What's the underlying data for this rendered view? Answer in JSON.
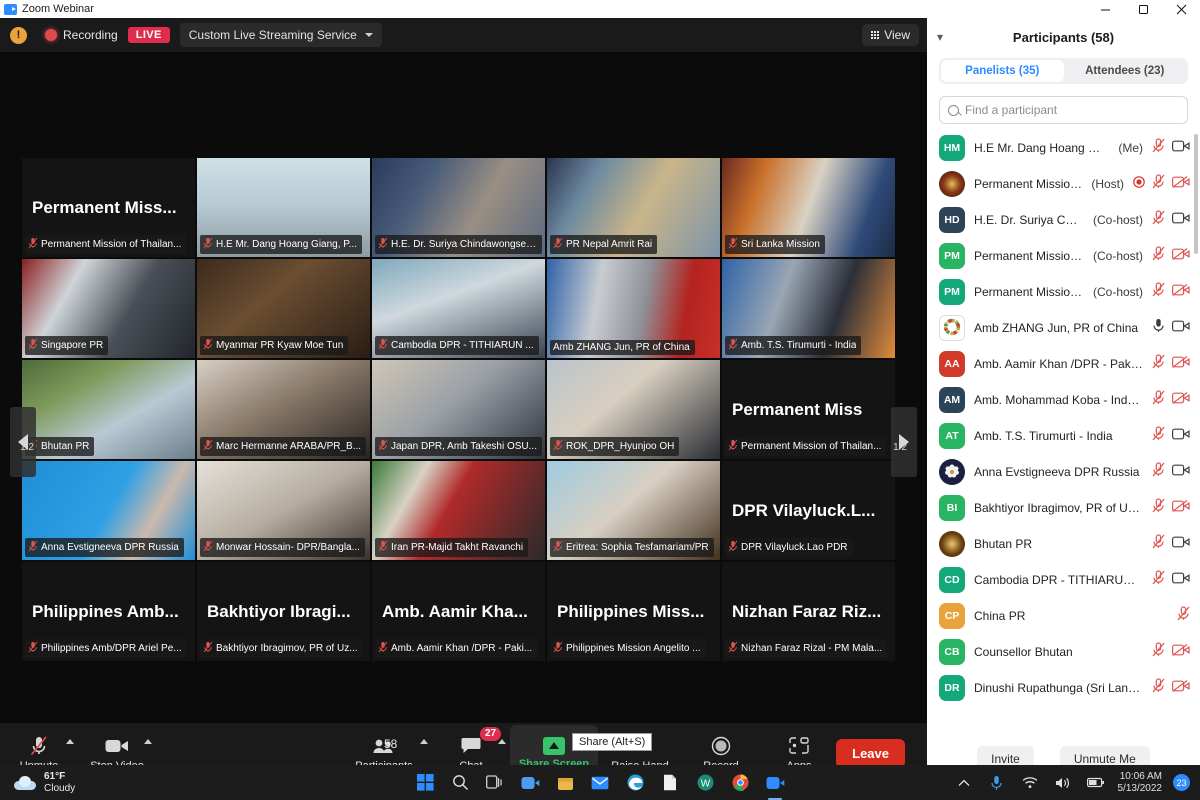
{
  "window": {
    "title": "Zoom Webinar",
    "minimize": "minimize-button",
    "maximize": "maximize-button",
    "close": "close-button"
  },
  "topbar": {
    "shield_icon": "security-shield-icon",
    "recording_label": "Recording",
    "live_badge": "LIVE",
    "stream_service": "Custom Live Streaming Service",
    "view_label": "View"
  },
  "stage": {
    "page_left": "1/2",
    "page_right": "1/2",
    "tiles": [
      {
        "name": "Permanent Mission of Thailan...",
        "big": "Permanent  Miss...",
        "muted": true,
        "style": "text",
        "bg": "#141414"
      },
      {
        "name": "H.E Mr. Dang Hoang Giang, P...",
        "muted": true,
        "style": "video",
        "bg": "linear-gradient(180deg,#cfe0e6 0%,#b9ccd4 45%,#8d9ba2 100%)"
      },
      {
        "name": "H.E. Dr. Suriya Chindawongse,...",
        "muted": true,
        "style": "video",
        "bg": "linear-gradient(120deg,#2a3a5c 0%,#4a5d7a 30%,#9a8f84 60%,#5c6a80 100%)"
      },
      {
        "name": "PR Nepal Amrit Rai",
        "muted": true,
        "style": "video",
        "bg": "linear-gradient(120deg,#2b3550 0%,#6d8aa0 25%,#c9b58a 55%,#7d94a8 100%)"
      },
      {
        "name": "Sri Lanka Mission",
        "muted": true,
        "style": "video",
        "bg": "linear-gradient(110deg,#6a2a22 0%,#c9702a 22%,#d9d2c4 50%,#2f4a7a 80%,#1d2b44 100%)"
      },
      {
        "name": "Singapore PR",
        "muted": true,
        "style": "video",
        "bg": "linear-gradient(120deg,#8a1f1f 0%,#cfd4d8 28%,#4a4f57 60%,#22262c 100%)"
      },
      {
        "name": "Myanmar PR Kyaw Moe Tun",
        "muted": true,
        "style": "video",
        "bg": "linear-gradient(140deg,#3b2a1d 0%,#6b4e32 40%,#2a1d14 100%)"
      },
      {
        "name": "Cambodia DPR - TITHIARUN ...",
        "muted": true,
        "style": "video",
        "bg": "linear-gradient(160deg,#7fa8bd 0%,#cfd8dd 40%,#3a4250 100%)"
      },
      {
        "name": "Amb ZHANG Jun, PR of China",
        "muted": false,
        "style": "video",
        "active": true,
        "bg": "linear-gradient(100deg,#2f63a8 0%,#c9ccd1 30%,#8f9299 55%,#b4231f 78%,#c8302a 100%)"
      },
      {
        "name": "Amb. T.S. Tirumurti - India",
        "muted": true,
        "style": "video",
        "bg": "linear-gradient(110deg,#2f63a8 0%,#9aa6b4 35%,#2b2f38 65%,#e08a3c 100%)"
      },
      {
        "name": "Bhutan PR",
        "muted": true,
        "style": "video",
        "bg": "linear-gradient(150deg,#4e6b3a 0%,#7f9a5c 30%,#b9c9d4 60%,#6b7f8c 100%)"
      },
      {
        "name": "Marc Hermanne ARABA/PR_B...",
        "muted": true,
        "style": "video",
        "bg": "linear-gradient(150deg,#d8cfc4 0%,#8a7b6a 45%,#2a2320 100%)"
      },
      {
        "name": "Japan DPR, Amb Takeshi OSU...",
        "muted": true,
        "style": "video",
        "bg": "linear-gradient(140deg,#cfc6b8 0%,#9aa0a6 45%,#2d333c 100%)"
      },
      {
        "name": "ROK_DPR_Hyunjoo OH",
        "muted": true,
        "style": "video",
        "bg": "linear-gradient(140deg,#b9c4cc 0%,#d8cfc0 40%,#2a2d33 100%)"
      },
      {
        "name": "Permanent Mission of Thailan...",
        "big": "Permanent  Miss",
        "muted": true,
        "style": "text",
        "bg": "#141414"
      },
      {
        "name": "Anna Evstigneeva DPR Russia",
        "muted": true,
        "style": "video",
        "bg": "linear-gradient(120deg,#1f8ed6 0%,#2fa0e4 50%,#cbb9ad 72%,#1f8ed6 100%)"
      },
      {
        "name": "Monwar Hossain- DPR/Bangla...",
        "muted": true,
        "style": "video",
        "bg": "linear-gradient(150deg,#e4e1da 0%,#b6ada0 50%,#3a332c 100%)"
      },
      {
        "name": "Iran PR-Majid Takht Ravanchi",
        "muted": true,
        "style": "video",
        "bg": "linear-gradient(120deg,#3a7a3a 0%,#d8d2c4 25%,#b02a2a 45%,#2a2a2a 100%)"
      },
      {
        "name": "Eritrea: Sophia Tesfamariam/PR",
        "muted": true,
        "style": "video",
        "bg": "linear-gradient(140deg,#9fcbe0 0%,#d8cfc2 45%,#43301f 100%)"
      },
      {
        "name": "DPR Vilayluck.Lao PDR",
        "big": "DPR Vilayluck.L...",
        "muted": true,
        "style": "text",
        "bg": "#141414"
      },
      {
        "name": "Philippines Amb/DPR Ariel Pe...",
        "big": "Philippines Amb...",
        "muted": true,
        "style": "text",
        "bg": "#141414"
      },
      {
        "name": "Bakhtiyor Ibragimov, PR of Uz...",
        "big": "Bakhtiyor Ibragi...",
        "muted": true,
        "style": "text",
        "bg": "#141414"
      },
      {
        "name": "Amb. Aamir Khan /DPR - Paki...",
        "big": "Amb. Aamir Kha...",
        "muted": true,
        "style": "text",
        "bg": "#141414"
      },
      {
        "name": "Philippines Mission Angelito ...",
        "big": "Philippines Miss...",
        "muted": true,
        "style": "text",
        "bg": "#141414"
      },
      {
        "name": "Nizhan Faraz Rizal - PM Mala...",
        "big": "Nizhan Faraz Riz...",
        "muted": true,
        "style": "text",
        "bg": "#141414"
      }
    ]
  },
  "toolbar": {
    "unmute": "Unmute",
    "stop_video": "Stop Video",
    "participants": "Participants",
    "participants_count": "58",
    "chat": "Chat",
    "chat_badge": "27",
    "share_screen": "Share Screen",
    "share_tooltip": "Share (Alt+S)",
    "raise_hand": "Raise Hand",
    "record": "Record",
    "apps": "Apps",
    "leave": "Leave"
  },
  "panel": {
    "title": "Participants (58)",
    "tabs": [
      {
        "label": "Panelists (35)",
        "active": true
      },
      {
        "label": "Attendees (23)",
        "active": false
      }
    ],
    "search_placeholder": "Find a participant",
    "invite": "Invite",
    "unmute_me": "Unmute Me",
    "participants": [
      {
        "initials": "HM",
        "color": "#13a97a",
        "name": "H.E Mr. Dang Hoang Gian...",
        "role": "(Me)",
        "mic": "muted",
        "cam": "on"
      },
      {
        "initials": "",
        "color": "#5d2a14",
        "name": "Permanent Mission ...",
        "role": "(Host)",
        "mic": "muted",
        "cam": "off",
        "host_dot": true,
        "photo": "crest"
      },
      {
        "initials": "HD",
        "color": "#2d4358",
        "name": "H.E. Dr. Suriya Chinda...",
        "role": "(Co-host)",
        "mic": "muted",
        "cam": "on"
      },
      {
        "initials": "PM",
        "color": "#28b463",
        "name": "Permanent Mission o...",
        "role": "(Co-host)",
        "mic": "muted",
        "cam": "off"
      },
      {
        "initials": "PM",
        "color": "#13a97a",
        "name": "Permanent Mission o...",
        "role": "(Co-host)",
        "mic": "muted",
        "cam": "off"
      },
      {
        "initials": "",
        "color": "#f2f2f2",
        "name": "Amb ZHANG Jun, PR of China",
        "role": "",
        "mic": "on",
        "cam": "on",
        "photo": "sdg"
      },
      {
        "initials": "AA",
        "color": "#cf3a2a",
        "name": "Amb. Aamir Khan /DPR - Pakist...",
        "role": "",
        "mic": "muted",
        "cam": "off"
      },
      {
        "initials": "AM",
        "color": "#2d4358",
        "name": "Amb. Mohammad Koba - Indon...",
        "role": "",
        "mic": "muted",
        "cam": "off"
      },
      {
        "initials": "AT",
        "color": "#28b463",
        "name": "Amb. T.S. Tirumurti - India",
        "role": "",
        "mic": "muted",
        "cam": "on"
      },
      {
        "initials": "",
        "color": "#1c1f40",
        "name": "Anna Evstigneeva DPR Russia",
        "role": "",
        "mic": "muted",
        "cam": "on",
        "photo": "eagle"
      },
      {
        "initials": "BI",
        "color": "#28b463",
        "name": "Bakhtiyor Ibragimov, PR of Uzb...",
        "role": "",
        "mic": "muted",
        "cam": "off"
      },
      {
        "initials": "",
        "color": "#5a3a1a",
        "name": "Bhutan PR",
        "role": "",
        "mic": "muted",
        "cam": "on",
        "photo": "emblem"
      },
      {
        "initials": "CD",
        "color": "#13a97a",
        "name": "Cambodia DPR - TITHIARUN M...",
        "role": "",
        "mic": "muted",
        "cam": "on"
      },
      {
        "initials": "CP",
        "color": "#e8a33d",
        "name": "China PR",
        "role": "",
        "mic": "muted",
        "cam": "none"
      },
      {
        "initials": "CB",
        "color": "#28b463",
        "name": "Counsellor Bhutan",
        "role": "",
        "mic": "muted",
        "cam": "off"
      },
      {
        "initials": "DR",
        "color": "#13a97a",
        "name": "Dinushi Rupathunga (Sri Lanka)",
        "role": "",
        "mic": "muted",
        "cam": "off"
      }
    ]
  },
  "taskbar": {
    "weather_temp": "61°F",
    "weather_cond": "Cloudy",
    "time": "10:06 AM",
    "date": "5/13/2022",
    "notification_count": "23"
  }
}
